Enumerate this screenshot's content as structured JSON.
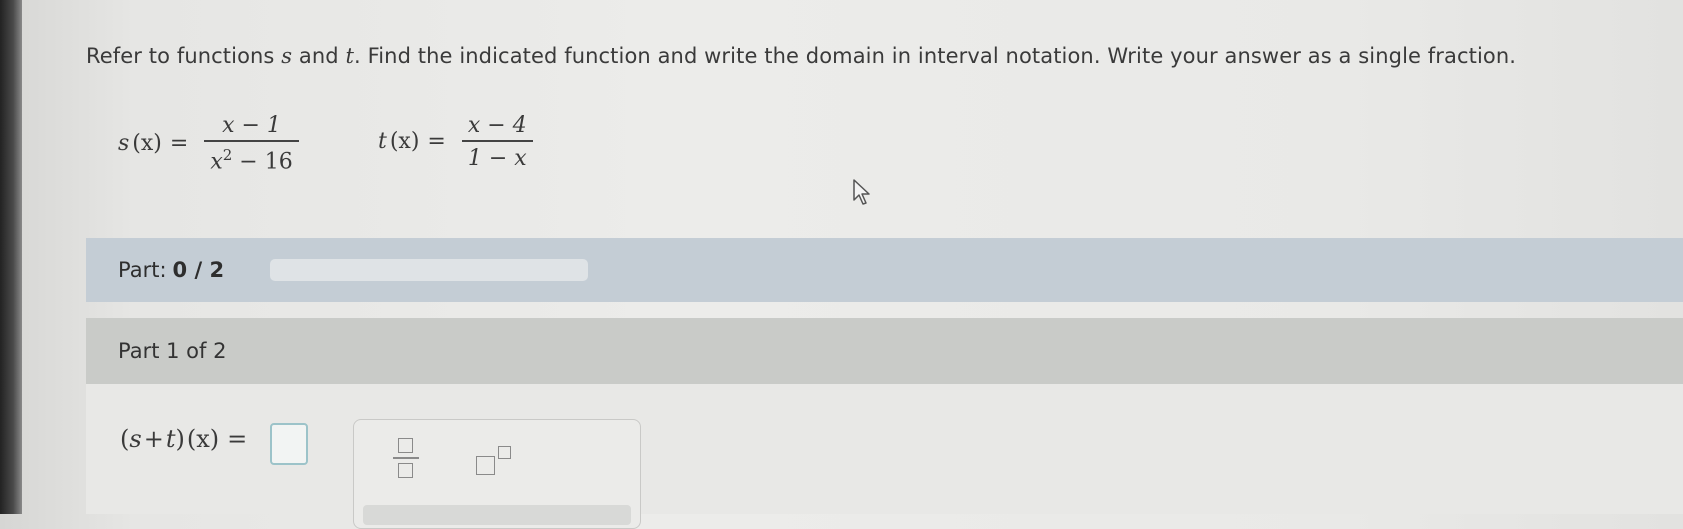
{
  "instructions": {
    "before_s": "Refer to functions ",
    "s": "s",
    "and": " and ",
    "t": "t",
    "after_t": ". Find the indicated function and write the domain in interval notation. Write your answer as a single fraction."
  },
  "functions": {
    "s": {
      "name": "s",
      "arg": "(x)",
      "eq": "=",
      "numerator": "x − 1",
      "denominator_base": "x",
      "denominator_exp": "2",
      "denominator_rest": " − 16"
    },
    "t": {
      "name": "t",
      "arg": "(x)",
      "eq": "=",
      "numerator": "x − 4",
      "denominator": "1 − x"
    }
  },
  "progress": {
    "label": "Part:",
    "value": "0 / 2",
    "fraction_complete": 0
  },
  "part": {
    "label": "Part 1 of 2"
  },
  "answer": {
    "expression_open": "(",
    "s": "s",
    "plus": "+",
    "t": "t",
    "expression_close": ")",
    "arg": "(x)",
    "eq": "="
  },
  "toolbox": {
    "fraction_tool_icon": "fraction-icon",
    "exponent_tool_icon": "superscript-icon"
  },
  "colors": {
    "part_bar": "#c4cdd5",
    "part1_bar": "#c9cbc8",
    "answer_box_border": "#9cc3c9"
  }
}
